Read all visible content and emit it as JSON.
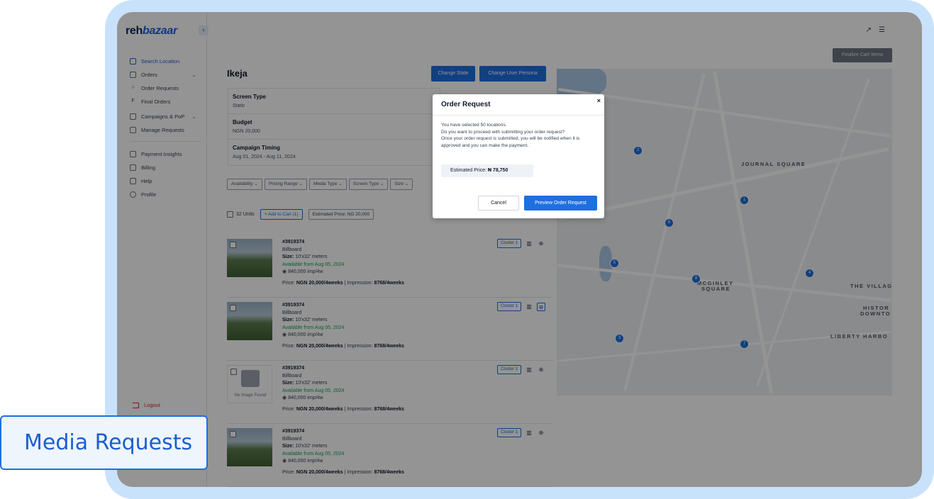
{
  "app": {
    "logo_main": "reh",
    "logo_accent": "bazaar"
  },
  "sidebar": {
    "items": [
      {
        "label": "Search Location",
        "active": true
      },
      {
        "label": "Orders"
      },
      {
        "label": "Order Requests"
      },
      {
        "label": "Final Orders"
      },
      {
        "label": "Campaigns & PoP"
      },
      {
        "label": "Manage Requests"
      },
      {
        "label": "Payment Insights"
      },
      {
        "label": "Billing"
      },
      {
        "label": "Help"
      },
      {
        "label": "Profile"
      }
    ],
    "logout": "Logout"
  },
  "topbar": {
    "finalize": "Finalize Cart Items"
  },
  "main": {
    "title": "Ikeja",
    "change_state": "Change State",
    "change_persona": "Change User Persona",
    "info": {
      "screen_type_label": "Screen Type",
      "screen_type_value": "Static",
      "budget_label": "Budget",
      "budget_value": "NGN 20,000",
      "timing_label": "Campaign Timing",
      "timing_value": "Aug 01, 2024 - Aug 11, 2024"
    },
    "filters": [
      "Availability",
      "Pricing Range",
      "Media Type",
      "Screen Type",
      "Size"
    ],
    "units": "32 Units",
    "add_to_cart": "Add to Cart (1)",
    "estimated_price": "Estimated Price: NG 20,000",
    "items": [
      {
        "id": "#3919374",
        "type": "Billboard",
        "size_label": "Size:",
        "size": "10'x32' meters",
        "avail_label": "Available from",
        "avail_date": "Aug 05, 2024",
        "imp": "840,000 imp/4w",
        "price_label": "Price:",
        "price": "NGN 20,000/4weeks",
        "impression_label": "| Impression:",
        "impression": "8768/4weeks",
        "cluster": "Cluster 1"
      },
      {
        "id": "#3919374",
        "type": "Billboard",
        "size_label": "Size:",
        "size": "10'x32' meters",
        "avail_label": "Available from",
        "avail_date": "Aug 05, 2024",
        "imp": "840,000 imp/4w",
        "price_label": "Price:",
        "price": "NGN 20,000/4weeks",
        "impression_label": "| Impression:",
        "impression": "8768/4weeks",
        "cluster": "Cluster 1"
      },
      {
        "id": "#3919374",
        "type": "Billboard",
        "size_label": "Size:",
        "size": "10'x32' meters",
        "avail_label": "Available from",
        "avail_date": "Aug 05, 2024",
        "imp": "840,000 imp/4w",
        "price_label": "Price:",
        "price": "NGN 20,000/4weeks",
        "impression_label": "| Impression:",
        "impression": "8768/4weeks",
        "cluster": "Cluster 1",
        "no_image": "No Image Found"
      },
      {
        "id": "#3919374",
        "type": "Billboard",
        "size_label": "Size:",
        "size": "10'x32' meters",
        "avail_label": "Available from",
        "avail_date": "Aug 05, 2024",
        "imp": "840,000 imp/4w",
        "price_label": "Price:",
        "price": "NGN 20,000/4weeks",
        "impression_label": "| Impression:",
        "impression": "8768/4weeks",
        "cluster": "Cluster 1"
      }
    ]
  },
  "map": {
    "labels": [
      "JOURNAL SQUARE",
      "MCGINLEY",
      "SQUARE",
      "THE VILLAG",
      "HISTOR",
      "DOWNTO",
      "LIBERTY HARBO"
    ],
    "pins": [
      "2",
      "1",
      "6",
      "5",
      "8",
      "4",
      "3",
      "7"
    ]
  },
  "modal": {
    "title": "Order Request",
    "close": "×",
    "line1": "You have selected 50 locations.",
    "line2": "Do you want to proceed with submitting your order request?",
    "line3": "Once your order request is submitted, you will be notified when it is approved and you can make the payment.",
    "est_label": "Estimated Price:",
    "est_value": "₦ 78,750",
    "cancel": "Cancel",
    "preview": "Preview Order Request"
  },
  "caption": "Media Requests"
}
